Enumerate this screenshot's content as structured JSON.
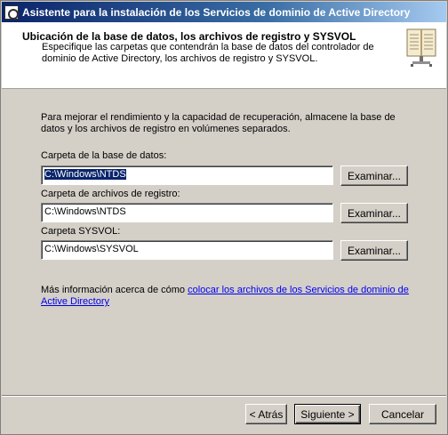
{
  "window": {
    "title": "Asistente para la instalación de los Servicios de dominio de Active Directory"
  },
  "header": {
    "title": "Ubicación de la base de datos, los archivos de registro y SYSVOL",
    "description": "Especifique las carpetas que contendrán la base de datos del controlador de dominio de Active Directory, los archivos de registro y SYSVOL.",
    "icon": "book-icon"
  },
  "intro": "Para mejorar el rendimiento y la capacidad de recuperación, almacene la base de datos y los archivos de registro en volúmenes separados.",
  "fields": {
    "database": {
      "label": "Carpeta de la base de datos:",
      "value": "C:\\Windows\\NTDS",
      "button": "Examinar..."
    },
    "logs": {
      "label": "Carpeta de archivos de registro:",
      "value": "C:\\Windows\\NTDS",
      "button": "Examinar..."
    },
    "sysvol": {
      "label": "Carpeta SYSVOL:",
      "value": "C:\\Windows\\SYSVOL",
      "button": "Examinar..."
    }
  },
  "more_info": {
    "prefix": "Más información acerca de cómo ",
    "link": "colocar los archivos de los Servicios de dominio de Active Directory"
  },
  "footer": {
    "back": "< Atrás",
    "next": "Siguiente >",
    "cancel": "Cancelar"
  }
}
